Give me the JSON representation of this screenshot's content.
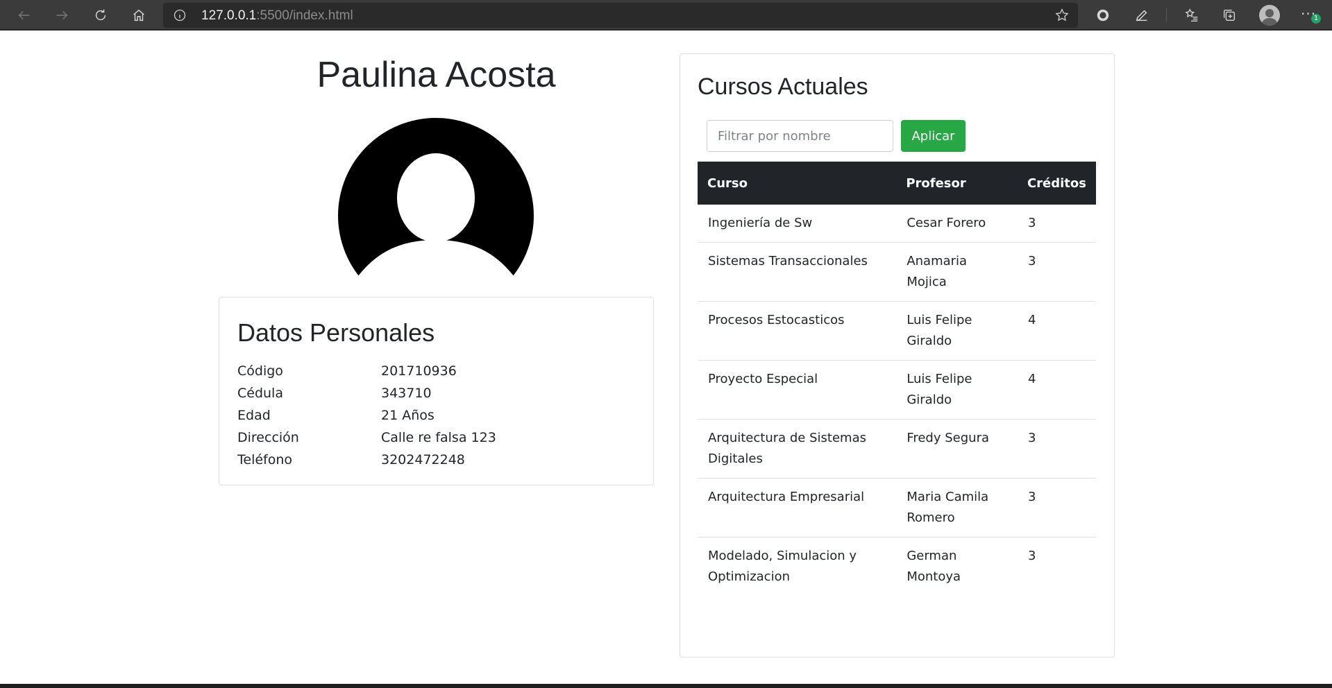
{
  "browser": {
    "url_host": "127.0.0.1",
    "url_rest": ":5500/index.html",
    "notification_badge": "1"
  },
  "profile": {
    "name": "Paulina Acosta",
    "section_title": "Datos Personales",
    "fields": [
      {
        "label": "Código",
        "value": "201710936"
      },
      {
        "label": "Cédula",
        "value": "343710"
      },
      {
        "label": "Edad",
        "value": "21 Años"
      },
      {
        "label": "Dirección",
        "value": "Calle re falsa 123"
      },
      {
        "label": "Teléfono",
        "value": "3202472248"
      }
    ]
  },
  "courses": {
    "title": "Cursos Actuales",
    "filter_placeholder": "Filtrar por nombre",
    "apply_label": "Aplicar",
    "headers": [
      "Curso",
      "Profesor",
      "Créditos"
    ],
    "rows": [
      [
        "Ingeniería de Sw",
        "Cesar Forero",
        "3"
      ],
      [
        "Sistemas Transaccionales",
        "Anamaria Mojica",
        "3"
      ],
      [
        "Procesos Estocasticos",
        "Luis Felipe Giraldo",
        "4"
      ],
      [
        "Proyecto Especial",
        "Luis Felipe Giraldo",
        "4"
      ],
      [
        "Arquitectura de Sistemas Digitales",
        "Fredy Segura",
        "3"
      ],
      [
        "Arquitectura Empresarial",
        "Maria Camila Romero",
        "3"
      ],
      [
        "Modelado, Simulacion y Optimizacion",
        "German Montoya",
        "3"
      ]
    ]
  },
  "colors": {
    "apply_button": "#28a745",
    "table_header": "#212529",
    "toolbar": "#3b3b3b"
  }
}
